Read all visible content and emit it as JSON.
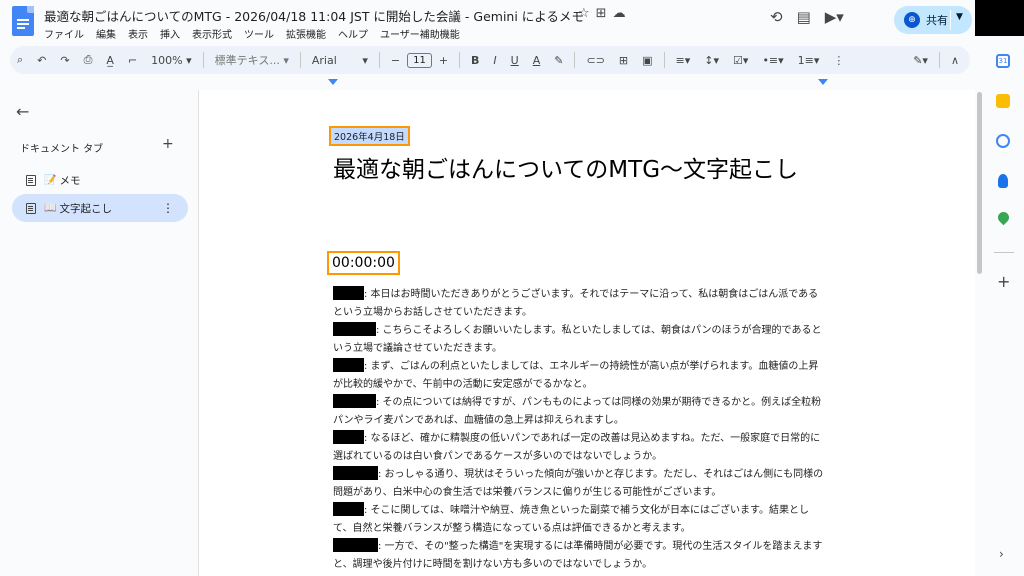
{
  "header": {
    "title": "最適な朝ごはんについてのMTG - 2026/04/18 11:04 JST に開始した会議 - Gemini によるメモ",
    "menu": [
      "ファイル",
      "編集",
      "表示",
      "挿入",
      "表示形式",
      "ツール",
      "拡張機能",
      "ヘルプ",
      "ユーザー補助機能"
    ],
    "share_label": "共有"
  },
  "toolbar": {
    "zoom": "100%",
    "style": "標準テキス...",
    "font": "Arial",
    "font_size": "11"
  },
  "sidebar": {
    "section_label": "ドキュメント タブ",
    "tabs": [
      {
        "emoji": "📝",
        "label": "メモ"
      },
      {
        "emoji": "📖",
        "label": "文字起こし"
      }
    ]
  },
  "document": {
    "date": "2026年4月18日",
    "title": "最適な朝ごはんについてのMTG〜文字起こし",
    "timestamp": "00:00:00",
    "paragraphs": [
      ": 本日はお時間いただきありがとうございます。それではテーマに沿って、私は朝食はごはん派であるという立場からお話しさせていただきます。",
      ": こちらこそよろしくお願いいたします。私といたしましては、朝食はパンのほうが合理的であるという立場で議論させていただきます。",
      ": まず、ごはんの利点といたしましては、エネルギーの持続性が高い点が挙げられます。血糖値の上昇が比較的緩やかで、午前中の活動に安定感がでるかなと。",
      ": その点については納得ですが、パンもものによっては同様の効果が期待できるかと。例えば全粒粉パンやライ麦パンであれば、血糖値の急上昇は抑えられますし。",
      ": なるほど、確かに精製度の低いパンであれば一定の改善は見込めますね。ただ、一般家庭で日常的に選ばれているのは白い食パンであるケースが多いのではないでしょうか。",
      ": おっしゃる通り、現状はそういった傾向が強いかと存じます。ただし、それはごはん側にも同様の問題があり、白米中心の食生活では栄養バランスに偏りが生じる可能性がございます。",
      ": そこに関しては、味噌汁や納豆、焼き魚といった副菜で補う文化が日本にはございます。結果として、自然と栄養バランスが整う構造になっている点は評価できるかと考えます。",
      ": 一方で、その\"整った構造\"を実現するには準備時間が必要です。現代の生活スタイルを踏まえますと、調理や後片付けに時間を割けない方も多いのではないでしょうか。"
    ]
  },
  "colors": {
    "highlight_border": "#ff9800",
    "active_tab": "#d3e3fd",
    "share_bg": "#c2e7ff"
  }
}
